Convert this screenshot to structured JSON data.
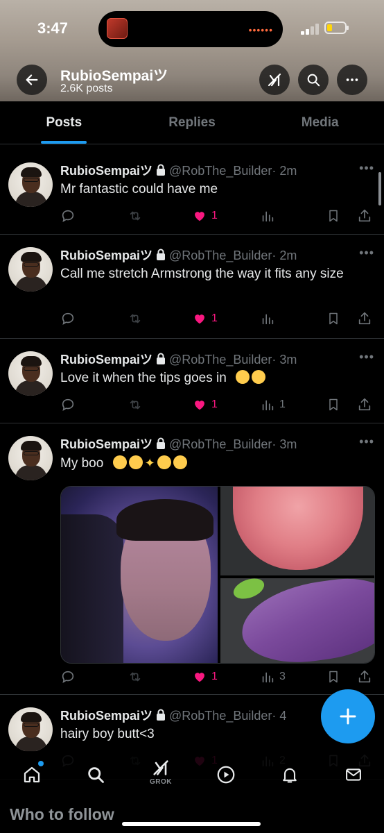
{
  "status_bar": {
    "time": "3:47",
    "island_indicator": "••••••"
  },
  "header": {
    "title": "RubioSempaiツ",
    "subtitle": "2.6K posts",
    "icons": [
      "back-arrow-icon",
      "grok-icon",
      "search-icon",
      "more-icon"
    ]
  },
  "tabs": [
    {
      "label": "Posts",
      "active": true
    },
    {
      "label": "Replies",
      "active": false
    },
    {
      "label": "Media",
      "active": false
    }
  ],
  "posts": [
    {
      "name": "RubioSempaiツ",
      "handle": "@RobThe_Builder",
      "time": "· 2m",
      "text": "Mr fantastic could have me",
      "likes": "1",
      "views": "",
      "liked": true
    },
    {
      "name": "RubioSempaiツ",
      "handle": "@RobThe_Builder",
      "time": "· 2m",
      "text": "Call me stretch Armstrong the way it fits any size",
      "likes": "1",
      "views": "",
      "liked": true
    },
    {
      "name": "RubioSempaiツ",
      "handle": "@RobThe_Builder",
      "time": "· 3m",
      "text": "Love it when the tips goes in",
      "emoji": [
        "weary-face-emoji",
        "weary-face-emoji"
      ],
      "likes": "1",
      "views": "1",
      "liked": true
    },
    {
      "name": "RubioSempaiツ",
      "handle": "@RobThe_Builder",
      "time": "· 3m",
      "text": "My boo",
      "emoji": [
        "kissing-face-emoji",
        "kissing-face-emoji",
        "sparkles-emoji",
        "yum-face-emoji",
        "yum-face-emoji"
      ],
      "likes": "1",
      "views": "3",
      "liked": true,
      "media": [
        "selfie-photo",
        "tongue-emoji-image",
        "eggplant-emoji-image"
      ]
    },
    {
      "name": "RubioSempaiツ",
      "handle": "@RobThe_Builder",
      "time": "· 4",
      "text": "hairy boy butt<3",
      "likes": "1",
      "views": "2",
      "liked": true
    }
  ],
  "fab": {
    "icon": "plus-icon"
  },
  "bottom_nav": {
    "items": [
      "home-icon",
      "search-icon",
      "grok-icon",
      "video-icon",
      "notifications-icon",
      "messages-icon"
    ],
    "grok_label": "GROK"
  },
  "who_to_follow": "Who to follow",
  "colors": {
    "accent": "#1d9bf0",
    "like": "#f91880",
    "muted": "#71767b",
    "background": "#000000"
  }
}
